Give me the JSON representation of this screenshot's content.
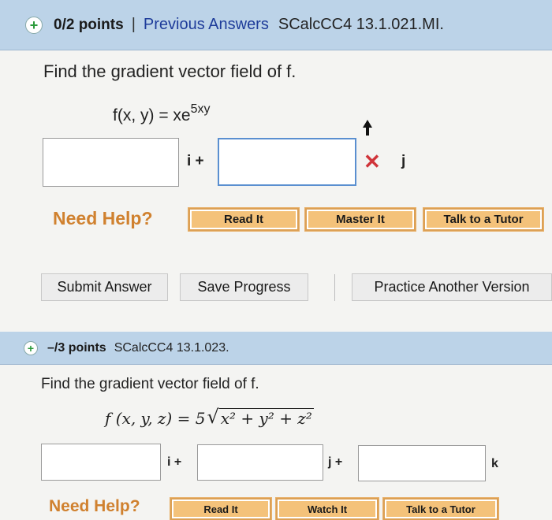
{
  "q1": {
    "points": "0/2 points",
    "separator": "|",
    "previous_answers": "Previous Answers",
    "problem_code": "SCalcCC4 13.1.021.MI.",
    "prompt": "Find the gradient vector field of f.",
    "formula_lhs": "f(x, y) = xe",
    "formula_exp": "5xy",
    "unit_i": "i +",
    "unit_j": "j",
    "x_mark": "✕",
    "need_help": "Need Help?",
    "help_buttons": [
      "Read It",
      "Master It",
      "Talk to a Tutor"
    ],
    "submit_label": "Submit Answer",
    "save_label": "Save Progress",
    "practice_label": "Practice Another Version"
  },
  "q2": {
    "points": "–/3 points",
    "problem_code": "SCalcCC4 13.1.023.",
    "prompt": "Find the gradient vector field of f.",
    "formula_pre": "f (x, y, z) = 5",
    "formula_radicand": "x² + y² + z²",
    "unit_i": "i +",
    "unit_j": "j +",
    "unit_k": "k",
    "need_help": "Need Help?",
    "help_buttons": [
      "Read It",
      "Watch It",
      "Talk to a Tutor"
    ]
  },
  "colors": {
    "header_bg": "#bcd3e8",
    "link_blue": "#1e3c9a",
    "help_orange": "#d0812f",
    "error_red": "#d0343a",
    "plus_green": "#2a9a3a"
  }
}
